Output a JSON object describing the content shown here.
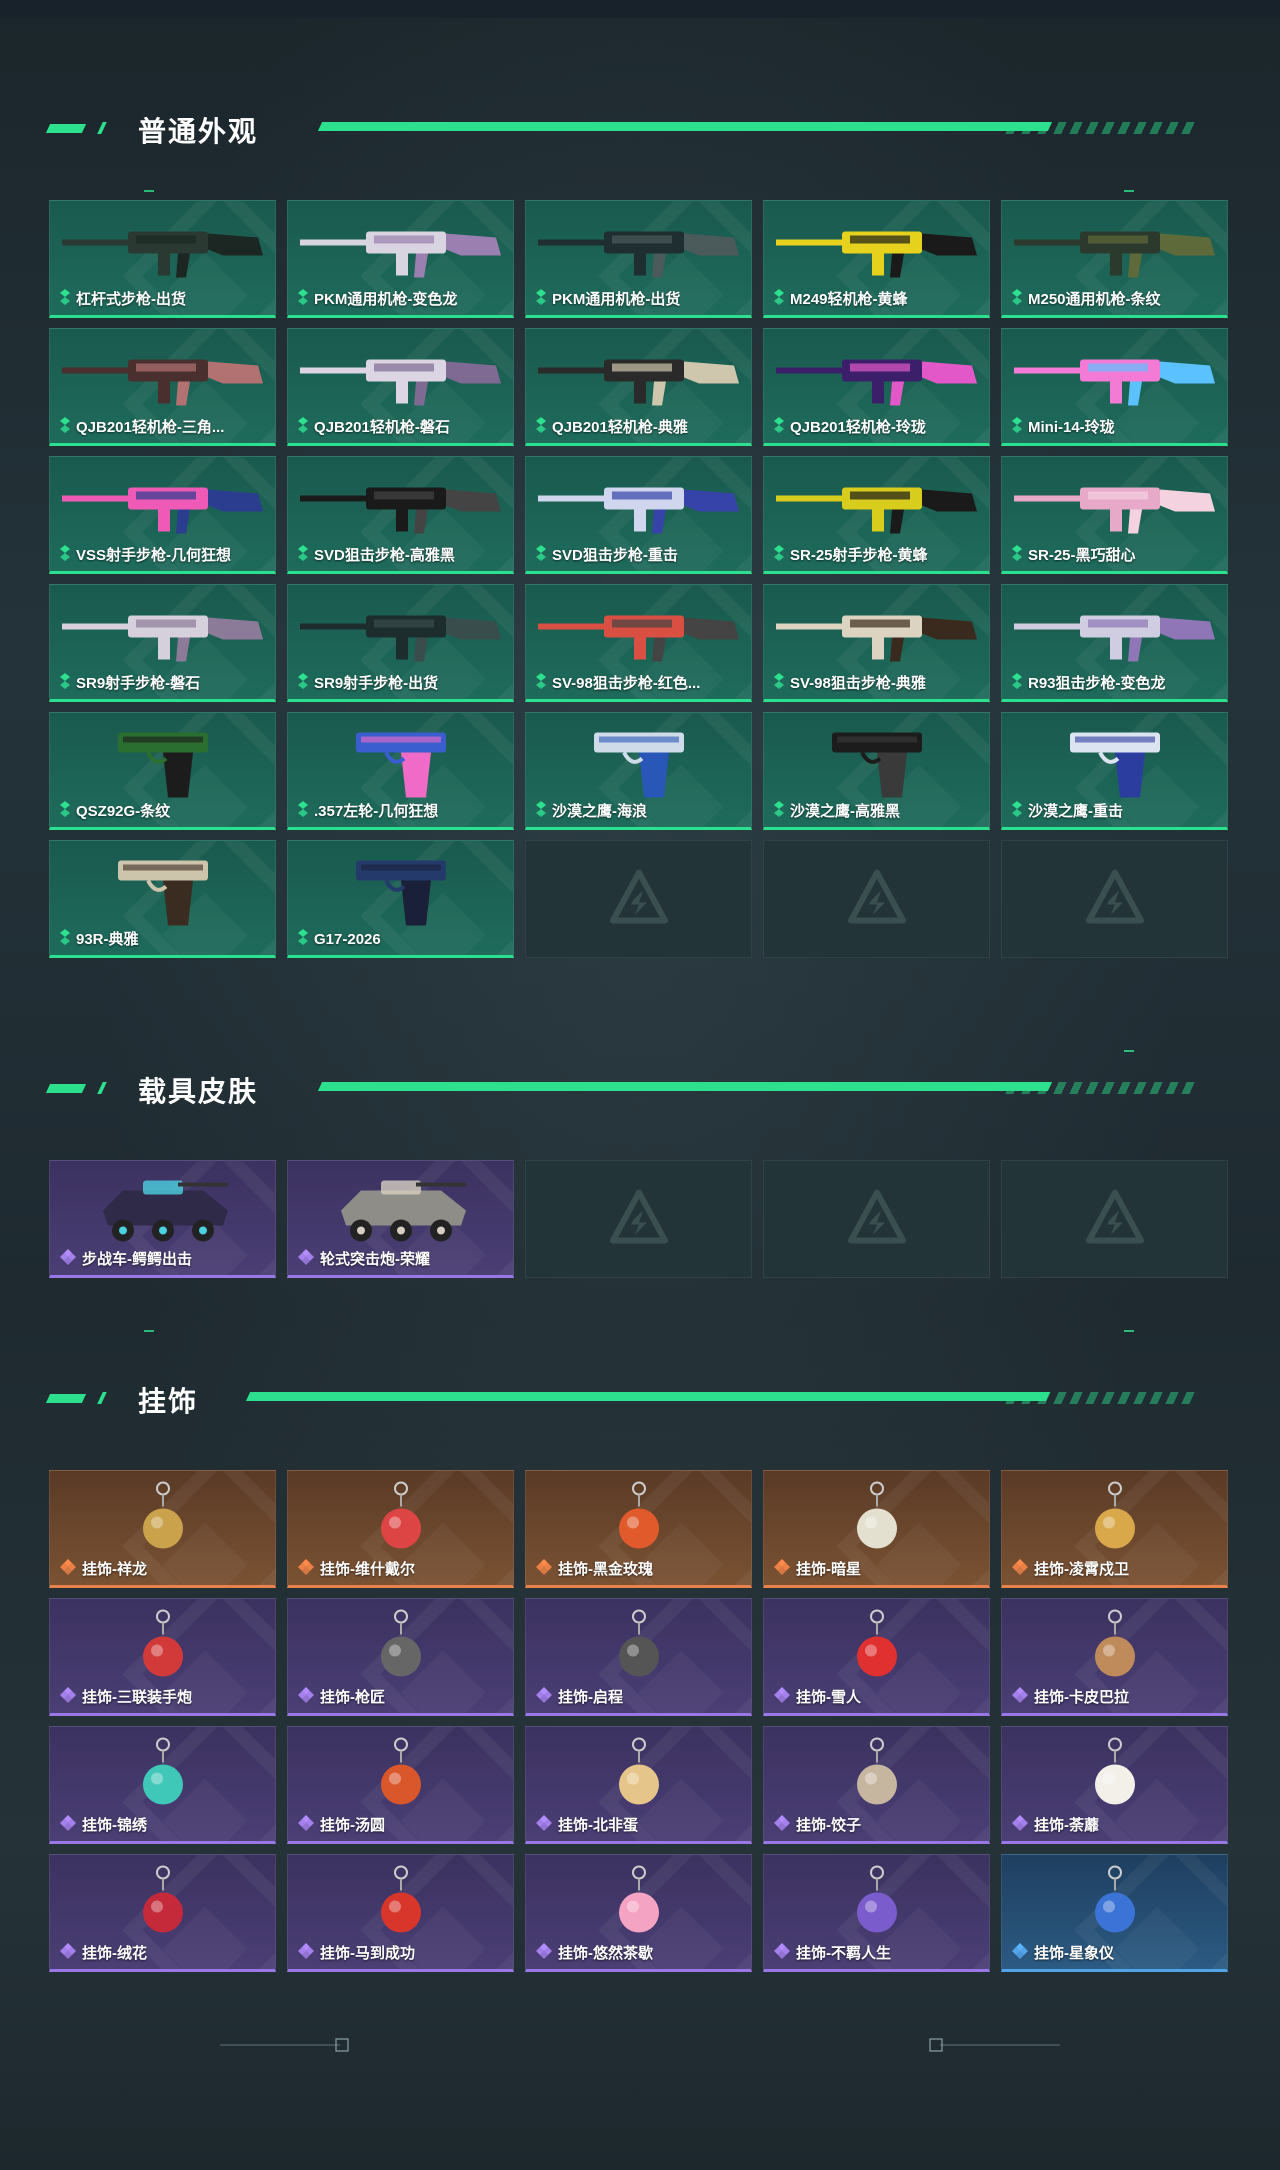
{
  "sections": {
    "weapons": {
      "title": "普通外观",
      "items": [
        {
          "label": "杠杆式步枪-出货",
          "rarity": "green"
        },
        {
          "label": "PKM通用机枪-变色龙",
          "rarity": "green"
        },
        {
          "label": "PKM通用机枪-出货",
          "rarity": "green"
        },
        {
          "label": "M249轻机枪-黄蜂",
          "rarity": "green"
        },
        {
          "label": "M250通用机枪-条纹",
          "rarity": "green"
        },
        {
          "label": "QJB201轻机枪-三角...",
          "rarity": "green"
        },
        {
          "label": "QJB201轻机枪-磐石",
          "rarity": "green"
        },
        {
          "label": "QJB201轻机枪-典雅",
          "rarity": "green"
        },
        {
          "label": "QJB201轻机枪-玲珑",
          "rarity": "green"
        },
        {
          "label": "Mini-14-玲珑",
          "rarity": "green"
        },
        {
          "label": "VSS射手步枪-几何狂想",
          "rarity": "green"
        },
        {
          "label": "SVD狙击步枪-高雅黑",
          "rarity": "green"
        },
        {
          "label": "SVD狙击步枪-重击",
          "rarity": "green"
        },
        {
          "label": "SR-25射手步枪-黄蜂",
          "rarity": "green"
        },
        {
          "label": "SR-25-黑巧甜心",
          "rarity": "green"
        },
        {
          "label": "SR9射手步枪-磐石",
          "rarity": "green"
        },
        {
          "label": "SR9射手步枪-出货",
          "rarity": "green"
        },
        {
          "label": "SV-98狙击步枪-红色...",
          "rarity": "green"
        },
        {
          "label": "SV-98狙击步枪-典雅",
          "rarity": "green"
        },
        {
          "label": "R93狙击步枪-变色龙",
          "rarity": "green"
        },
        {
          "label": "QSZ92G-条纹",
          "rarity": "green"
        },
        {
          "label": ".357左轮-几何狂想",
          "rarity": "green"
        },
        {
          "label": "沙漠之鹰-海浪",
          "rarity": "green"
        },
        {
          "label": "沙漠之鹰-高雅黑",
          "rarity": "green"
        },
        {
          "label": "沙漠之鹰-重击",
          "rarity": "green"
        },
        {
          "label": "93R-典雅",
          "rarity": "green"
        },
        {
          "label": "G17-2026",
          "rarity": "green"
        },
        {
          "label": "",
          "rarity": "empty"
        },
        {
          "label": "",
          "rarity": "empty"
        },
        {
          "label": "",
          "rarity": "empty"
        }
      ]
    },
    "vehicles": {
      "title": "载具皮肤",
      "items": [
        {
          "label": "步战车-鳄鳄出击",
          "rarity": "purple"
        },
        {
          "label": "轮式突击炮-荣耀",
          "rarity": "purple"
        },
        {
          "label": "",
          "rarity": "empty"
        },
        {
          "label": "",
          "rarity": "empty"
        },
        {
          "label": "",
          "rarity": "empty"
        }
      ]
    },
    "charms": {
      "title": "挂饰",
      "items": [
        {
          "label": "挂饰-祥龙",
          "rarity": "orange"
        },
        {
          "label": "挂饰-维什戴尔",
          "rarity": "orange"
        },
        {
          "label": "挂饰-黑金玫瑰",
          "rarity": "orange"
        },
        {
          "label": "挂饰-暗星",
          "rarity": "orange"
        },
        {
          "label": "挂饰-凌霄戍卫",
          "rarity": "orange"
        },
        {
          "label": "挂饰-三联装手炮",
          "rarity": "purple"
        },
        {
          "label": "挂饰-枪匠",
          "rarity": "purple"
        },
        {
          "label": "挂饰-启程",
          "rarity": "purple"
        },
        {
          "label": "挂饰-雪人",
          "rarity": "purple"
        },
        {
          "label": "挂饰-卡皮巴拉",
          "rarity": "purple"
        },
        {
          "label": "挂饰-锦绣",
          "rarity": "purple"
        },
        {
          "label": "挂饰-汤圆",
          "rarity": "purple"
        },
        {
          "label": "挂饰-北非蛋",
          "rarity": "purple"
        },
        {
          "label": "挂饰-饺子",
          "rarity": "purple"
        },
        {
          "label": "挂饰-荼蘼",
          "rarity": "purple"
        },
        {
          "label": "挂饰-绒花",
          "rarity": "purple"
        },
        {
          "label": "挂饰-马到成功",
          "rarity": "purple"
        },
        {
          "label": "挂饰-悠然茶歇",
          "rarity": "purple"
        },
        {
          "label": "挂饰-不羁人生",
          "rarity": "purple"
        },
        {
          "label": "挂饰-星象仪",
          "rarity": "blue"
        }
      ]
    }
  },
  "colors": {
    "accent": "#2de08e",
    "green_border": "#2de08e",
    "purple_border": "#9a77e6",
    "orange_border": "#e8814a",
    "blue_border": "#4fa3e6"
  },
  "icons": {
    "rarity": "diamond-rarity-icon",
    "empty_slot": "triangle-logo-icon"
  }
}
